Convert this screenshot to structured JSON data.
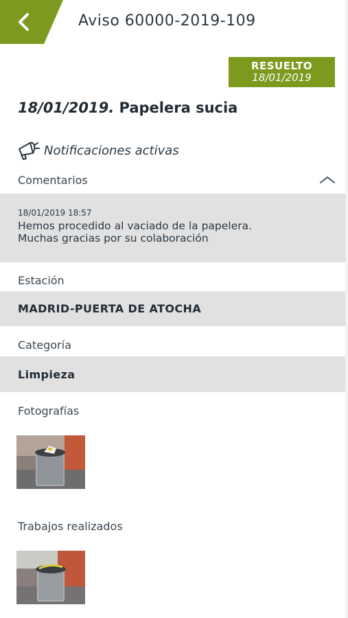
{
  "header": {
    "title": "Aviso 60000-2019-109",
    "back_icon": "chevron-left-icon",
    "accent_color": "#7d9a1e"
  },
  "status": {
    "label": "RESUELTO",
    "date": "18/01/2019",
    "color": "#7d9a1e"
  },
  "incident": {
    "date": "18/01/2019.",
    "title": "Papelera sucia"
  },
  "notifications": {
    "icon": "megaphone-icon",
    "label": "Notificaciones activas"
  },
  "comments": {
    "label": "Comentarios",
    "toggle_icon": "chevron-up-icon",
    "items": [
      {
        "timestamp": "18/01/2019 18:57",
        "text": "Hemos procedido al vaciado de la papelera.\nMuchas gracias por su colaboración"
      }
    ]
  },
  "station": {
    "label": "Estación",
    "value": "MADRID-PUERTA DE ATOCHA"
  },
  "category": {
    "label": "Categoría",
    "value": "Limpieza"
  },
  "photos": {
    "label": "Fotografías",
    "items": [
      {
        "icon": "photo-thumbnail-icon"
      }
    ]
  },
  "works": {
    "label": "Trabajos realizados",
    "items": [
      {
        "icon": "photo-thumbnail-icon"
      }
    ]
  }
}
